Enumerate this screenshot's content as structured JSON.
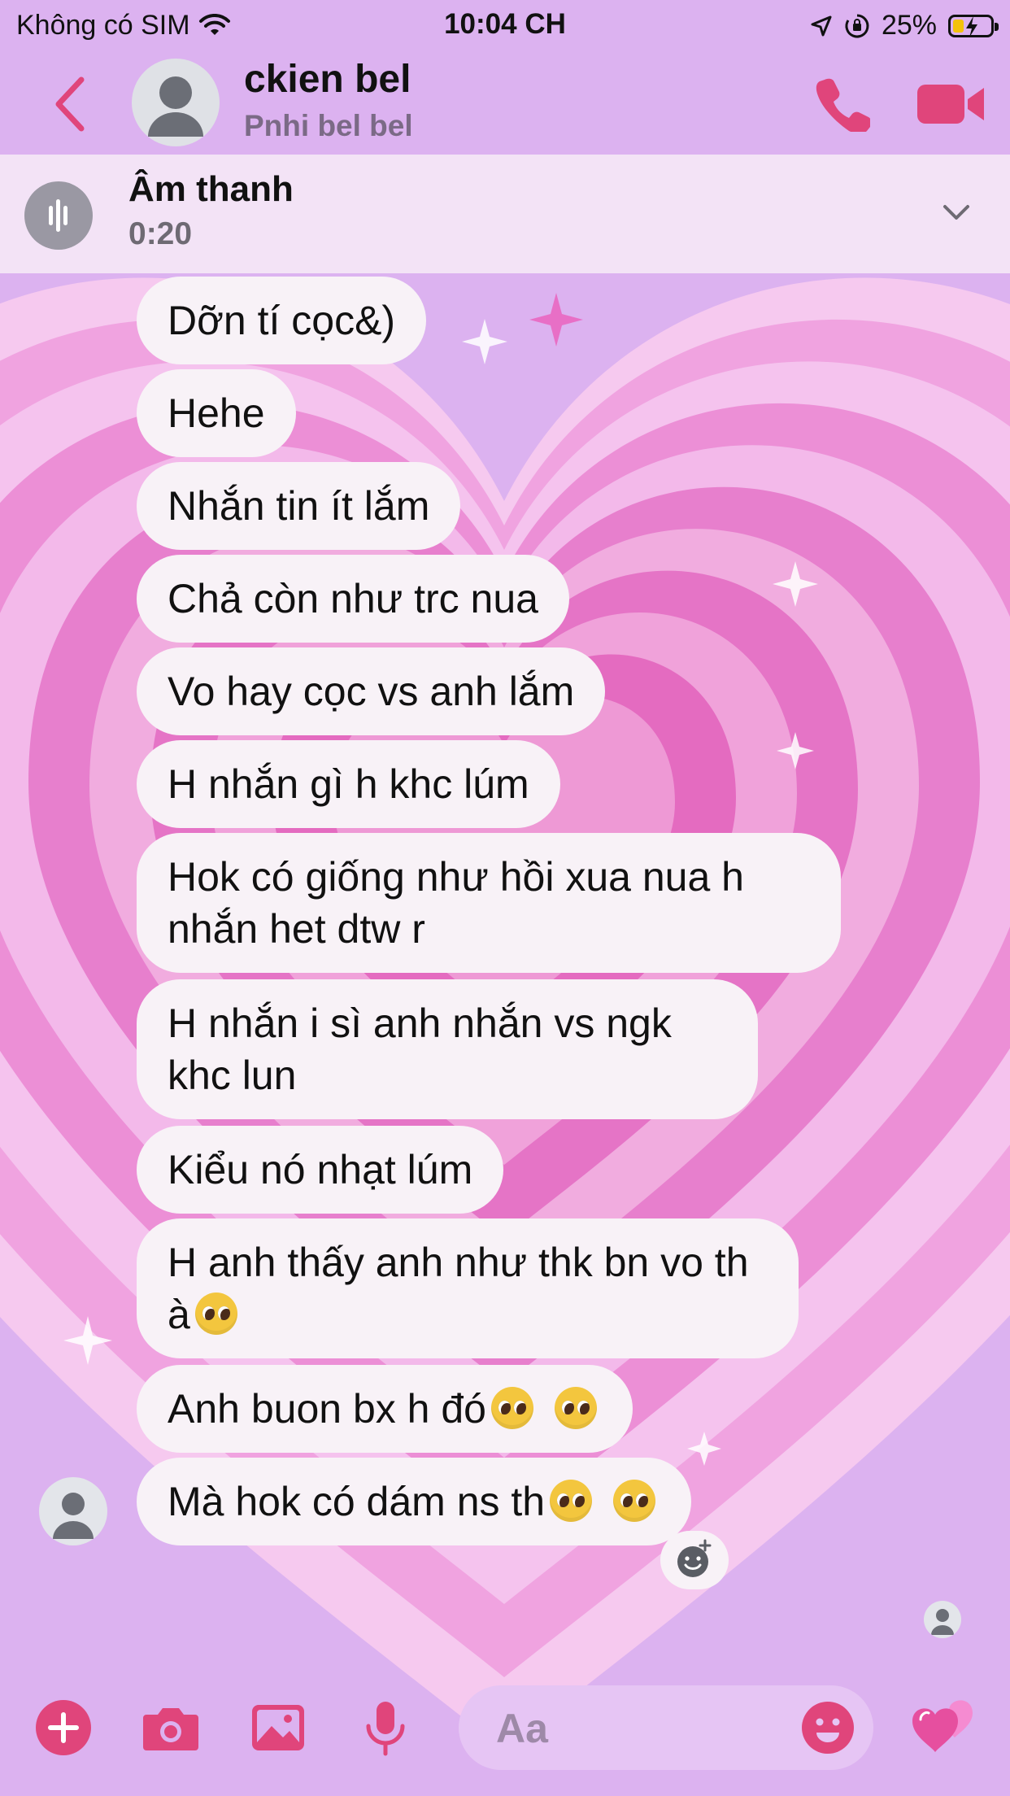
{
  "status_bar": {
    "carrier": "Không có SIM",
    "time": "10:04 CH",
    "battery_percent": "25%",
    "battery_level": 0.25,
    "icons": [
      "wifi-icon",
      "location-arrow-icon",
      "rotation-lock-icon",
      "battery-charging-icon"
    ]
  },
  "header": {
    "contact_name": "ckien bel",
    "nickname": "Pnhi bel bel",
    "icons": [
      "back-chevron-icon",
      "avatar-icon",
      "phone-icon",
      "video-camera-icon"
    ]
  },
  "audio_banner": {
    "title": "Âm thanh",
    "duration": "0:20",
    "icons": [
      "audio-wave-icon",
      "chevron-down-icon"
    ]
  },
  "messages": [
    {
      "text": "Dỡn tí cọc&)"
    },
    {
      "text": "Hehe"
    },
    {
      "text": "Nhắn tin ít lắm"
    },
    {
      "text": "Chả còn như trc nua"
    },
    {
      "text": "Vo hay cọc vs anh lắm"
    },
    {
      "text": "H nhắn gì h khc lúm"
    },
    {
      "text": "Hok có giống như hồi xua nua h nhắn het dtw r"
    },
    {
      "text": "H nhắn i sì anh nhắn vs ngk khc lun"
    },
    {
      "text": "Kiểu nó nhạt lúm"
    },
    {
      "text": "H anh thấy anh như thk bn vo th à",
      "emoji": [
        "pleading-face"
      ]
    },
    {
      "text": "Anh buon bx h đó",
      "emoji": [
        "pleading-face",
        "pleading-face"
      ]
    },
    {
      "text": "Mà hok có dám ns th",
      "emoji": [
        "pleading-face",
        "pleading-face"
      ]
    }
  ],
  "composer": {
    "placeholder": "Aa",
    "icons": [
      "plus-icon",
      "camera-icon",
      "image-icon",
      "microphone-icon",
      "emoji-icon",
      "hearts-icon"
    ]
  },
  "colors": {
    "accent": "#e0457b",
    "header_bg": "#dcb2f0",
    "bubble_bg": "#f8f2f7",
    "banner_bg": "#f3e3f6"
  }
}
